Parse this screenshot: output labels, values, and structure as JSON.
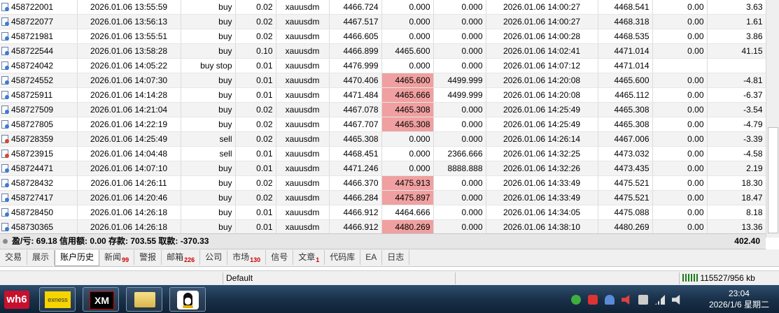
{
  "rows": [
    [
      "458722001",
      "2026.01.06 13:55:59",
      "buy",
      "0.02",
      "xauusdm",
      "4466.724",
      "0.000",
      "0.000",
      "2026.01.06 14:00:27",
      "4468.541",
      "0.00",
      "3.63"
    ],
    [
      "458722077",
      "2026.01.06 13:56:13",
      "buy",
      "0.02",
      "xauusdm",
      "4467.517",
      "0.000",
      "0.000",
      "2026.01.06 14:00:27",
      "4468.318",
      "0.00",
      "1.61"
    ],
    [
      "458721981",
      "2026.01.06 13:55:51",
      "buy",
      "0.02",
      "xauusdm",
      "4466.605",
      "0.000",
      "0.000",
      "2026.01.06 14:00:28",
      "4468.535",
      "0.00",
      "3.86"
    ],
    [
      "458722544",
      "2026.01.06 13:58:28",
      "buy",
      "0.10",
      "xauusdm",
      "4466.899",
      "4465.600",
      "0.000",
      "2026.01.06 14:02:41",
      "4471.014",
      "0.00",
      "41.15"
    ],
    [
      "458724042",
      "2026.01.06 14:05:22",
      "buy stop",
      "0.01",
      "xauusdm",
      "4476.999",
      "0.000",
      "0.000",
      "2026.01.06 14:07:12",
      "4471.014",
      "",
      ""
    ],
    [
      "458724552",
      "2026.01.06 14:07:30",
      "buy",
      "0.01",
      "xauusdm",
      "4470.406",
      "4465.600",
      "4499.999",
      "2026.01.06 14:20:08",
      "4465.600",
      "0.00",
      "-4.81"
    ],
    [
      "458725911",
      "2026.01.06 14:14:28",
      "buy",
      "0.01",
      "xauusdm",
      "4471.484",
      "4465.666",
      "4499.999",
      "2026.01.06 14:20:08",
      "4465.112",
      "0.00",
      "-6.37"
    ],
    [
      "458727509",
      "2026.01.06 14:21:04",
      "buy",
      "0.02",
      "xauusdm",
      "4467.078",
      "4465.308",
      "0.000",
      "2026.01.06 14:25:49",
      "4465.308",
      "0.00",
      "-3.54"
    ],
    [
      "458727805",
      "2026.01.06 14:22:19",
      "buy",
      "0.02",
      "xauusdm",
      "4467.707",
      "4465.308",
      "0.000",
      "2026.01.06 14:25:49",
      "4465.308",
      "0.00",
      "-4.79"
    ],
    [
      "458728359",
      "2026.01.06 14:25:49",
      "sell",
      "0.02",
      "xauusdm",
      "4465.308",
      "0.000",
      "0.000",
      "2026.01.06 14:26:14",
      "4467.006",
      "0.00",
      "-3.39"
    ],
    [
      "458723915",
      "2026.01.06 14:04:48",
      "sell",
      "0.01",
      "xauusdm",
      "4468.451",
      "0.000",
      "2366.666",
      "2026.01.06 14:32:25",
      "4473.032",
      "0.00",
      "-4.58"
    ],
    [
      "458724471",
      "2026.01.06 14:07:10",
      "buy",
      "0.01",
      "xauusdm",
      "4471.246",
      "0.000",
      "8888.888",
      "2026.01.06 14:32:26",
      "4473.435",
      "0.00",
      "2.19"
    ],
    [
      "458728432",
      "2026.01.06 14:26:11",
      "buy",
      "0.02",
      "xauusdm",
      "4466.370",
      "4475.913",
      "0.000",
      "2026.01.06 14:33:49",
      "4475.521",
      "0.00",
      "18.30"
    ],
    [
      "458727417",
      "2026.01.06 14:20:46",
      "buy",
      "0.02",
      "xauusdm",
      "4466.284",
      "4475.897",
      "0.000",
      "2026.01.06 14:33:49",
      "4475.521",
      "0.00",
      "18.47"
    ],
    [
      "458728450",
      "2026.01.06 14:26:18",
      "buy",
      "0.01",
      "xauusdm",
      "4466.912",
      "4464.666",
      "0.000",
      "2026.01.06 14:34:05",
      "4475.088",
      "0.00",
      "8.18"
    ],
    [
      "458730365",
      "2026.01.06 14:26:18",
      "buy",
      "0.01",
      "xauusdm",
      "4466.912",
      "4480.269",
      "0.000",
      "2026.01.06 14:38:10",
      "4480.269",
      "0.00",
      "13.36"
    ]
  ],
  "highlight_rows": [
    5,
    6,
    7,
    8,
    12,
    13,
    15
  ],
  "summary": {
    "text": "盈/亏: 69.18  信用额: 0.00  存款: 703.55  取款: -370.33",
    "total": "402.40"
  },
  "tabs": [
    {
      "label": "交易",
      "badge": ""
    },
    {
      "label": "展示",
      "badge": ""
    },
    {
      "label": "账户历史",
      "badge": "",
      "active": true
    },
    {
      "label": "新闻",
      "badge": "99"
    },
    {
      "label": "警报",
      "badge": ""
    },
    {
      "label": "邮箱",
      "badge": "226"
    },
    {
      "label": "公司",
      "badge": ""
    },
    {
      "label": "市场",
      "badge": "130"
    },
    {
      "label": "信号",
      "badge": ""
    },
    {
      "label": "文章",
      "badge": "1"
    },
    {
      "label": "代码库",
      "badge": ""
    },
    {
      "label": "EA",
      "badge": ""
    },
    {
      "label": "日志",
      "badge": ""
    }
  ],
  "status": {
    "profile": "Default",
    "traffic": "115527/956 kb"
  },
  "taskbar": {
    "apps": [
      "wh6",
      "exness",
      "XM",
      "file-explorer",
      "QQ"
    ],
    "time": "23:04",
    "date": "2026/1/6 星期二"
  },
  "colors": {
    "highlight": "#f0a0a0",
    "buy_dot": "#3a7bd5",
    "sell_dot": "#d9462b"
  }
}
